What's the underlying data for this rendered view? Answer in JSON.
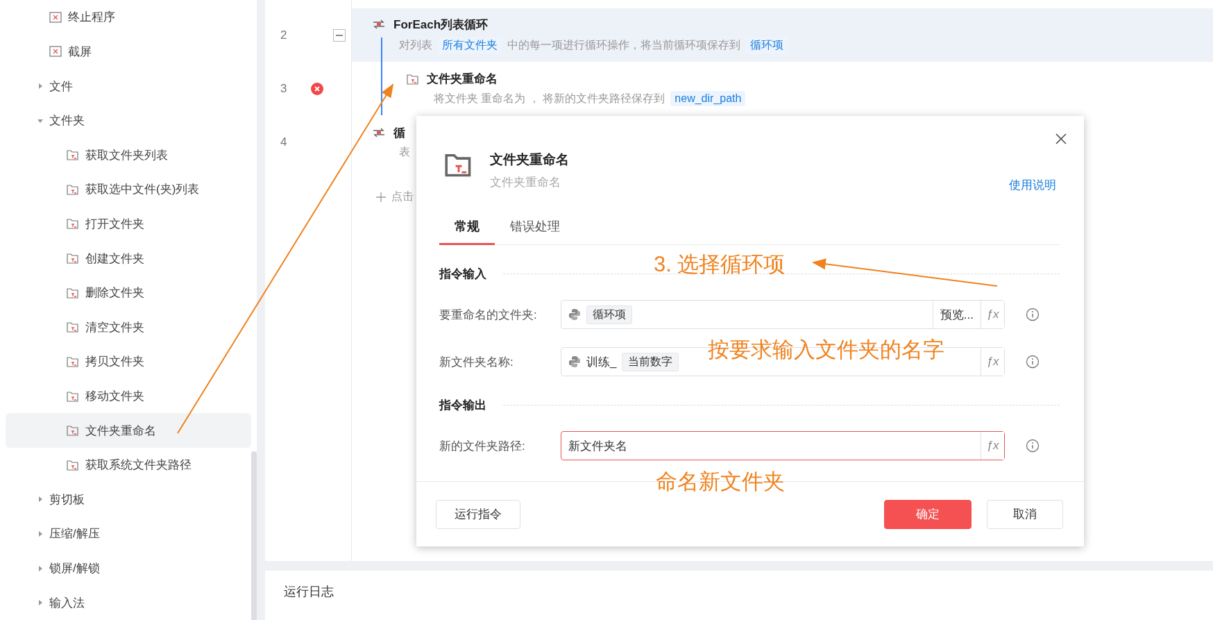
{
  "sidebar": {
    "items": [
      {
        "label": "终止程序",
        "kind": "action",
        "selected": false
      },
      {
        "label": "截屏",
        "kind": "action",
        "selected": false
      },
      {
        "label": "文件",
        "kind": "group",
        "expanded": false
      },
      {
        "label": "文件夹",
        "kind": "group",
        "expanded": true,
        "children": [
          {
            "label": "获取文件夹列表",
            "kind": "action",
            "selected": false
          },
          {
            "label": "获取选中文件(夹)列表",
            "kind": "action",
            "selected": false
          },
          {
            "label": "打开文件夹",
            "kind": "action",
            "selected": false
          },
          {
            "label": "创建文件夹",
            "kind": "action",
            "selected": false
          },
          {
            "label": "删除文件夹",
            "kind": "action",
            "selected": false
          },
          {
            "label": "清空文件夹",
            "kind": "action",
            "selected": false
          },
          {
            "label": "拷贝文件夹",
            "kind": "action",
            "selected": false
          },
          {
            "label": "移动文件夹",
            "kind": "action",
            "selected": false
          },
          {
            "label": "文件夹重命名",
            "kind": "action",
            "selected": true
          },
          {
            "label": "获取系统文件夹路径",
            "kind": "action",
            "selected": false
          }
        ]
      },
      {
        "label": "剪切板",
        "kind": "group",
        "expanded": false
      },
      {
        "label": "压缩/解压",
        "kind": "group",
        "expanded": false
      },
      {
        "label": "锁屏/解锁",
        "kind": "group",
        "expanded": false
      },
      {
        "label": "输入法",
        "kind": "group",
        "expanded": false
      }
    ]
  },
  "flow": {
    "steps": [
      {
        "number": "2",
        "title": "ForEach列表循环",
        "selected": true,
        "expanded": true,
        "error": false,
        "description": [
          {
            "kind": "text",
            "text": "对列表"
          },
          {
            "kind": "variable",
            "text": "所有文件夹"
          },
          {
            "kind": "text",
            "text": "中的每一项进行循环操作，将当前循环项保存到"
          },
          {
            "kind": "variable",
            "text": "循环项"
          }
        ],
        "children": [
          {
            "number": "3",
            "title": "文件夹重命名",
            "selected": false,
            "error": true,
            "description": [
              {
                "kind": "text",
                "text": "将文件夹 重命名为 ， 将新的文件夹路径保存到"
              },
              {
                "kind": "variable",
                "text": "new_dir_path"
              }
            ]
          }
        ]
      },
      {
        "number": "4",
        "title": "循",
        "selected": false,
        "error": false,
        "description": [
          {
            "kind": "text",
            "text": "表"
          }
        ]
      }
    ],
    "add_step": "点击"
  },
  "log_panel": {
    "title": "运行日志"
  },
  "dialog": {
    "title": "文件夹重命名",
    "subtitle": "文件夹重命名",
    "help_link": "使用说明",
    "tabs": [
      {
        "label": "常规",
        "selected": true
      },
      {
        "label": "错误处理",
        "selected": false
      }
    ],
    "sections": [
      {
        "title": "指令输入",
        "fields": [
          {
            "label": "要重命名的文件夹:",
            "kind": "expression",
            "error": false,
            "tokens": [
              {
                "kind": "chip",
                "text": "循环项"
              }
            ],
            "preview_button": "预览...",
            "function_button": "ƒx"
          },
          {
            "label": "新文件夹名称:",
            "kind": "expression",
            "error": false,
            "tokens": [
              {
                "kind": "text",
                "text": "训练_"
              },
              {
                "kind": "chip",
                "text": "当前数字"
              }
            ],
            "function_button": "ƒx"
          }
        ]
      },
      {
        "title": "指令输出",
        "fields": [
          {
            "label": "新的文件夹路径:",
            "kind": "plain",
            "error": true,
            "value": "新文件夹名",
            "function_button": "ƒx"
          }
        ]
      }
    ],
    "buttons": [
      {
        "label": "运行指令",
        "kind": "default"
      },
      {
        "label": "确定",
        "kind": "primary"
      },
      {
        "label": "取消",
        "kind": "default"
      }
    ]
  },
  "annotations": [
    {
      "text": "3. 选择循环项"
    },
    {
      "text": "按要求输入文件夹的名字"
    },
    {
      "text": "命名新文件夹"
    }
  ]
}
